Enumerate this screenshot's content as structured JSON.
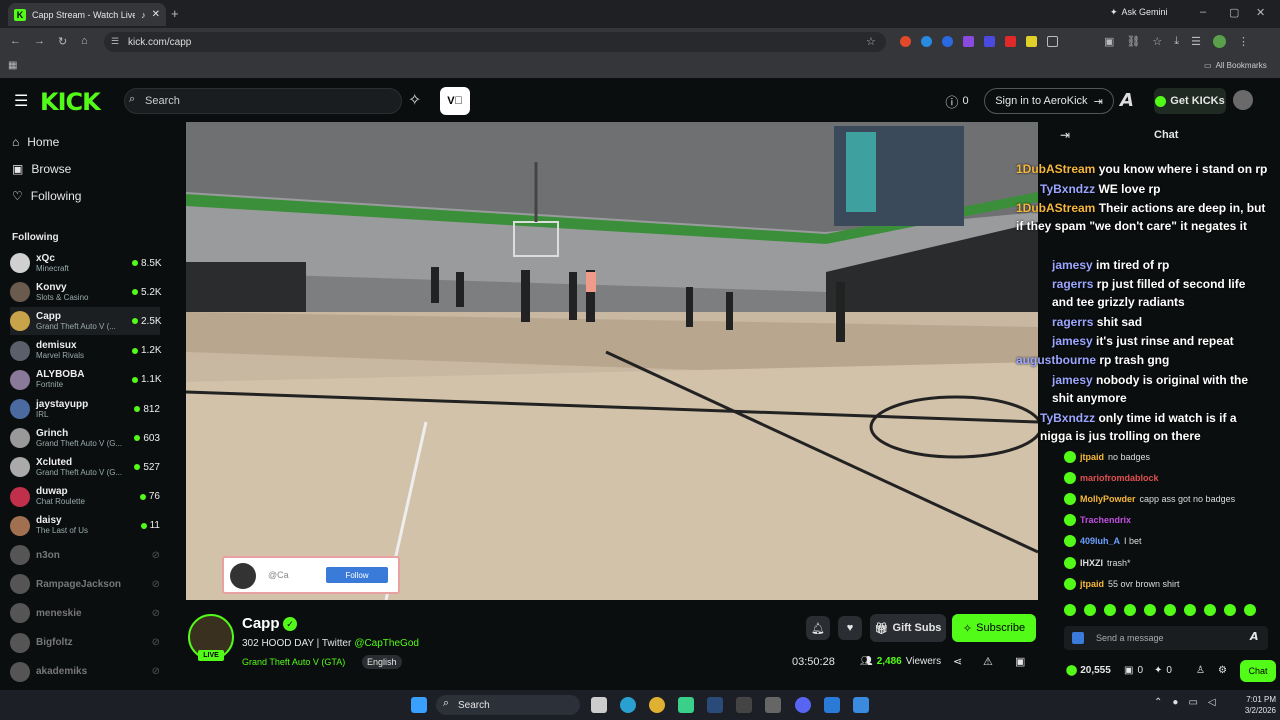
{
  "browser": {
    "tab_title": "Capp Stream - Watch Live",
    "url": "kick.com/capp",
    "ask_gemini": "Ask Gemini",
    "all_bookmarks": "All Bookmarks"
  },
  "header": {
    "logo": "KICK",
    "search_placeholder": "Search",
    "notif_count": "0",
    "sign_in": "Sign in to AeroKick",
    "get_kicks": "Get KICKs"
  },
  "sidebar": {
    "nav": [
      {
        "label": "Home",
        "icon": "home-icon"
      },
      {
        "label": "Browse",
        "icon": "browse-icon"
      },
      {
        "label": "Following",
        "icon": "heart-icon"
      }
    ],
    "following_title": "Following",
    "channels": [
      {
        "name": "xQc",
        "category": "Minecraft",
        "viewers": "8.5K",
        "live": true,
        "color": "#d0d0d0"
      },
      {
        "name": "Konvy",
        "category": "Slots & Casino",
        "viewers": "5.2K",
        "live": true,
        "color": "#6b5a4e"
      },
      {
        "name": "Capp",
        "category": "Grand Theft Auto V (...",
        "viewers": "2.5K",
        "live": true,
        "color": "#c9a34a"
      },
      {
        "name": "demisux",
        "category": "Marvel Rivals",
        "viewers": "1.2K",
        "live": true,
        "color": "#5a5f6a"
      },
      {
        "name": "ALYBOBA",
        "category": "Fortnite",
        "viewers": "1.1K",
        "live": true,
        "color": "#8a7a9a"
      },
      {
        "name": "jaystayupp",
        "category": "IRL",
        "viewers": "812",
        "live": true,
        "color": "#4a6aa0"
      },
      {
        "name": "Grinch",
        "category": "Grand Theft Auto V (G...",
        "viewers": "603",
        "live": true,
        "color": "#999"
      },
      {
        "name": "Xcluted",
        "category": "Grand Theft Auto V (G...",
        "viewers": "527",
        "live": true,
        "color": "#aaa"
      },
      {
        "name": "duwap",
        "category": "Chat Roulette",
        "viewers": "76",
        "live": true,
        "color": "#c0304a"
      },
      {
        "name": "daisy",
        "category": "The Last of Us",
        "viewers": "11",
        "live": true,
        "color": "#a07050"
      },
      {
        "name": "n3on",
        "category": "",
        "viewers": "",
        "live": false,
        "color": "#555"
      },
      {
        "name": "RampageJackson",
        "category": "",
        "viewers": "",
        "live": false,
        "color": "#555"
      },
      {
        "name": "meneskie",
        "category": "",
        "viewers": "",
        "live": false,
        "color": "#555"
      },
      {
        "name": "Bigfoltz",
        "category": "",
        "viewers": "",
        "live": false,
        "color": "#555"
      },
      {
        "name": "akademiks",
        "category": "",
        "viewers": "",
        "live": false,
        "color": "#555"
      }
    ]
  },
  "video": {
    "overlay_handle": "@Ca",
    "overlay_follow": "Follow"
  },
  "stream": {
    "name": "Capp",
    "title": "302 HOOD DAY | Twitter",
    "twitter": "@CapTheGod",
    "category": "Grand Theft Auto V (GTA)",
    "language": "English",
    "live_badge": "LIVE",
    "uptime": "03:50:28",
    "viewers": "2,486",
    "viewers_label": "Viewers",
    "gift_subs": "Gift Subs",
    "subscribe": "Subscribe"
  },
  "chat": {
    "title": "Chat",
    "messages": [
      {
        "user": "jtpaid",
        "text": "no badges",
        "color": "#f5b83d"
      },
      {
        "user": "mariofromdablock",
        "text": "",
        "color": "#e05050"
      },
      {
        "user": "MollyPowder",
        "text": "capp ass got no badges",
        "color": "#f5b83d"
      },
      {
        "user": "Trachendrix",
        "text": "",
        "color": "#c050e0"
      },
      {
        "user": "409luh_A",
        "text": "I bet",
        "color": "#6aa0ff"
      },
      {
        "user": "IHXZI",
        "text": "trash*",
        "color": "#dddddd"
      },
      {
        "user": "jtpaid",
        "text": "55 ovr brown shirt",
        "color": "#f5b83d"
      }
    ],
    "overlay": [
      {
        "user": "1DubAStream",
        "text": "you know where i stand on rp"
      },
      {
        "user": "TyBxndzz",
        "text": "WE love rp"
      },
      {
        "user": "1DubAStream",
        "text": "Their actions are deep in, but if they spam \"we don't care\" it negates it"
      },
      {
        "user": "jamesy",
        "text": "im tired of rp"
      },
      {
        "user": "ragerrs",
        "text": "rp just filled of second life and tee grizzly radiants"
      },
      {
        "user": "ragerrs",
        "text": "shit sad"
      },
      {
        "user": "jamesy",
        "text": "it's just rinse and repeat"
      },
      {
        "user": "augustbourne",
        "text": "rp trash gng"
      },
      {
        "user": "jamesy",
        "text": "nobody is original with the shit anymore"
      },
      {
        "user": "TyBxndzz",
        "text": "only time id watch is if a nigga is jus trolling on there"
      }
    ],
    "input_placeholder": "Send a message",
    "kicks_count": "20,555",
    "zero1": "0",
    "zero2": "0",
    "chat_button": "Chat"
  },
  "taskbar": {
    "search": "Search",
    "time": "7:01 PM",
    "date": "3/2/2026"
  }
}
